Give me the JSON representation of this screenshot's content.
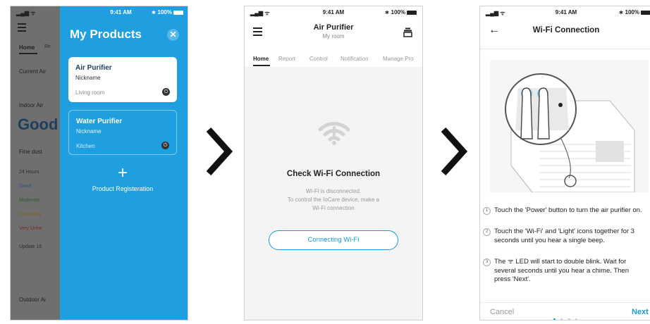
{
  "status_bar": {
    "time": "9:41 AM",
    "battery": "100%",
    "signal": "ull ✦"
  },
  "screen1": {
    "background_fragments": [
      "Home",
      "Re",
      "Current Air",
      "Indoor Air",
      "Good",
      "Fine dust",
      "24 Hours",
      "Good",
      "Moderate",
      "Unhealthy",
      "Very Unhe",
      "Update 16",
      "Outdoor Ai"
    ],
    "drawer": {
      "title": "My Products",
      "products": [
        {
          "name": "Air Purifier",
          "nickname": "Nickname",
          "location": "Living room"
        },
        {
          "name": "Water Purifier",
          "nickname": "Nickname",
          "location": "Kitchen"
        }
      ],
      "register_label": "Product Registeration"
    }
  },
  "screen2": {
    "title": "Air Purifier",
    "subtitle": "My room",
    "tabs": [
      "Home",
      "Report",
      "Control",
      "Notification",
      "Manage Pro"
    ],
    "heading": "Check Wi-Fi Connection",
    "message_lines": [
      "Wi-Fi is disconnected.",
      "To control the IoCare device, make a",
      "Wi-Fi connection"
    ],
    "button_label": "Connecting Wi-Fi"
  },
  "screen3": {
    "title": "Wi-Fi Connection",
    "steps": [
      {
        "num": "1",
        "text": "Touch the 'Power' button to turn the air purifier on."
      },
      {
        "num": "2",
        "text": "Touch the 'Wi-Fi' and 'Light' icons together for 3 seconds until you hear a single beep."
      },
      {
        "num": "3",
        "text": "The ᯤ LED will start to double blink. Wait for several seconds until you hear a chime. Then press 'Next'."
      }
    ],
    "cancel_label": "Cancel",
    "next_label": "Next",
    "page_total": 4,
    "page_current": 1
  },
  "colors": {
    "accent": "#1f9fe0",
    "link": "#1a9ad6",
    "dim_overlay": "#6f6f6f"
  },
  "icons": [
    "menu-icon",
    "close-icon",
    "power-icon",
    "plus-icon",
    "filter-icon",
    "wifi-icon",
    "back-arrow-icon",
    "chevron-right-icon"
  ]
}
